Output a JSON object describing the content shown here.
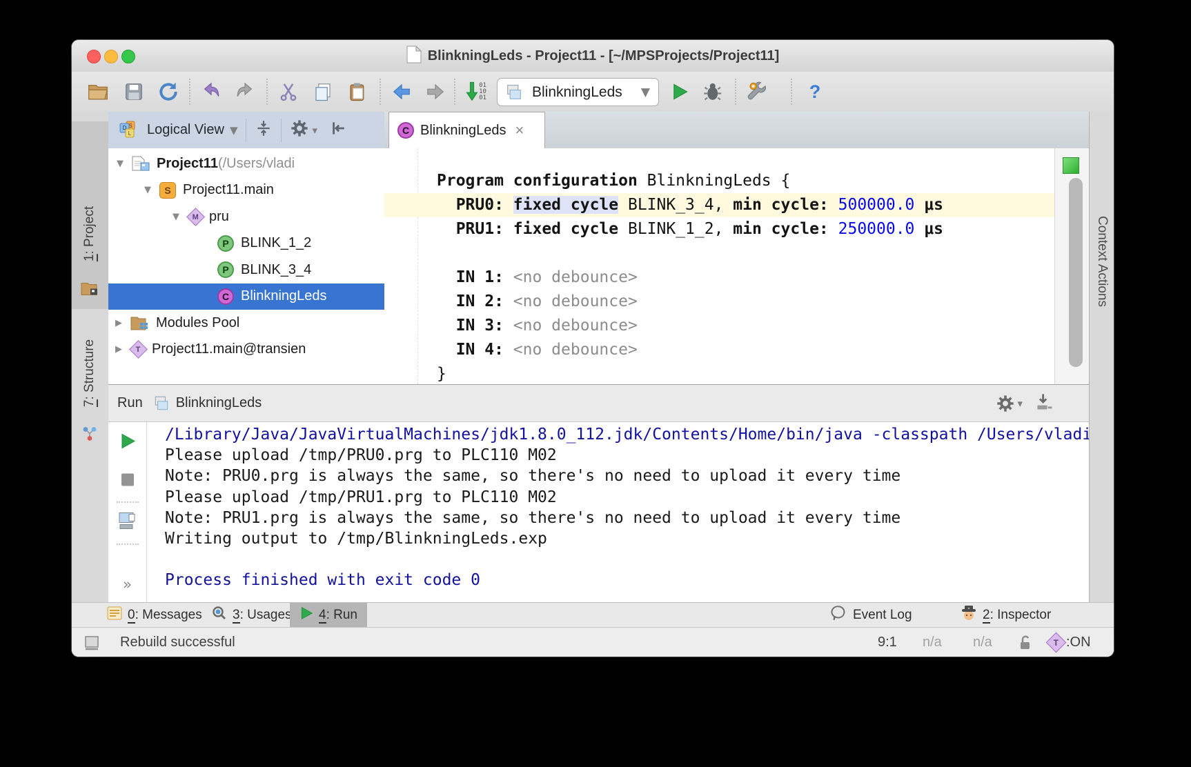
{
  "window": {
    "title": "BlinkningLeds - Project11 - [~/MPSProjects/Project11]"
  },
  "toolbar": {
    "run_config": "BlinkningLeds",
    "generate_digits": [
      "01",
      "10",
      "01"
    ],
    "help_label": "?",
    "combo_caret": "▼"
  },
  "left_stripe": {
    "project": {
      "num": "1",
      "rest": ": Project"
    },
    "structure": {
      "num": "7",
      "rest": ": Structure"
    }
  },
  "right_stripe": {
    "label": "Context Actions"
  },
  "project_panel": {
    "view_mode": "Logical View",
    "view_caret": "▼",
    "tree": [
      {
        "label": "Project11",
        "suffix": " (/Users/vladi",
        "chevron": "▼"
      },
      {
        "label": "Project11.main",
        "chevron": "▼",
        "icon_letter": "S"
      },
      {
        "label": "pru",
        "chevron": "▼",
        "icon_letter": "M"
      },
      {
        "label": "BLINK_1_2",
        "icon_letter": "P"
      },
      {
        "label": "BLINK_3_4",
        "icon_letter": "P"
      },
      {
        "label": "BlinkningLeds",
        "icon_letter": "C"
      },
      {
        "label": "Modules Pool",
        "chevron": "▶"
      },
      {
        "label": "Project11.main@transien",
        "chevron": "▶",
        "icon_letter": "T"
      }
    ]
  },
  "editor": {
    "tab": {
      "label": "BlinkningLeds",
      "icon_letter": "C",
      "close": "×"
    },
    "code": {
      "l1": {
        "kw": "Program configuration ",
        "name": "BlinkningLeds ",
        "brace": "{"
      },
      "l2": {
        "indent": "  ",
        "label": "PRU0: ",
        "sel": "fixed cycle",
        "ref": " BLINK_3_4, ",
        "kw": "min cycle: ",
        "num": "500000.0",
        "unit": " μs"
      },
      "l3": {
        "indent": "  ",
        "label": "PRU1: ",
        "sel": "fixed cycle",
        "ref": " BLINK_1_2, ",
        "kw": "min cycle: ",
        "num": "250000.0",
        "unit": " μs"
      },
      "l4": {
        "indent": "  ",
        "label": "IN 1: ",
        "value": "<no debounce>"
      },
      "l5": {
        "indent": "  ",
        "label": "IN 2: ",
        "value": "<no debounce>"
      },
      "l6": {
        "indent": "  ",
        "label": "IN 3: ",
        "value": "<no debounce>"
      },
      "l7": {
        "indent": "  ",
        "label": "IN 4: ",
        "value": "<no debounce>"
      },
      "l8": {
        "brace": "}"
      }
    }
  },
  "run_panel": {
    "title": "Run",
    "target": "BlinkningLeds",
    "expand_icon": "»",
    "console": [
      "/Library/Java/JavaVirtualMachines/jdk1.8.0_112.jdk/Contents/Home/bin/java -classpath /Users/vladi",
      "Please upload /tmp/PRU0.prg to PLC110 M02",
      "Note: PRU0.prg is always the same, so there's no need to upload it every time",
      "Please upload /tmp/PRU1.prg to PLC110 M02",
      "Note: PRU1.prg is always the same, so there's no need to upload it every time",
      "Writing output to /tmp/BlinkningLeds.exp",
      "",
      "Process finished with exit code 0"
    ]
  },
  "bottom_bar": {
    "messages": {
      "num": "0",
      "rest": ": Messages"
    },
    "usages": {
      "num": "3",
      "rest": ": Usages"
    },
    "run": {
      "num": "4",
      "rest": ": Run"
    },
    "event_log": "Event Log",
    "inspector": {
      "num": "2",
      "rest": ": Inspector"
    }
  },
  "status_bar": {
    "message": "Rebuild successful",
    "caret_position": "9:1",
    "na1": "n/a",
    "na2": "n/a",
    "transient_letter": "T",
    "transient_label": ":ON"
  },
  "colors": {
    "selection_blue": "#3875D2",
    "run_green": "#2EA94C",
    "code_number_blue": "#0609EA",
    "console_system_blue": "#12129E",
    "current_line_yellow": "#FEF9DF",
    "cell_selection_lavender": "#DFE3F8",
    "panel_header_blue": "#CBD5E4"
  }
}
